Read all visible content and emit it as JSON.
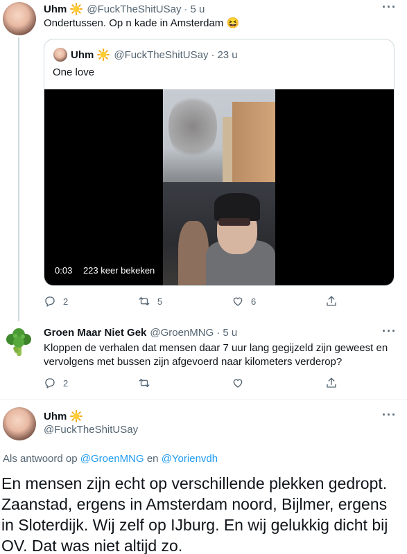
{
  "tweet1": {
    "name": "Uhm",
    "handle": "@FuckTheShitUSay",
    "dot": "·",
    "time": "5 u",
    "text": "Ondertussen. Op n kade in Amsterdam 😆",
    "quote": {
      "name": "Uhm",
      "handle": "@FuckTheShitUSay",
      "dot": "·",
      "time": "23 u",
      "text": "One love",
      "video_time": "0:03",
      "video_views": "223 keer bekeken"
    },
    "replies": "2",
    "retweets": "5",
    "likes": "6"
  },
  "tweet2": {
    "name": "Groen Maar Niet Gek",
    "handle": "@GroenMNG",
    "dot": "·",
    "time": "5 u",
    "text": "Kloppen de verhalen dat mensen daar 7 uur lang gegijzeld zijn geweest en vervolgens met bussen zijn afgevoerd naar kilometers verderop?",
    "replies": "2"
  },
  "tweet3": {
    "name": "Uhm",
    "handle": "@FuckTheShitUSay",
    "reply_prefix": "Als antwoord op",
    "reply_user1": "@GroenMNG",
    "reply_and": "en",
    "reply_user2": "@Yorienvdh",
    "text": "En mensen zijn echt op verschillende plekken gedropt. Zaanstad, ergens in Amsterdam noord, Bijlmer, ergens in Sloterdijk. Wij zelf op IJburg. En wij gelukkig dicht bij OV. Dat was niet altijd zo."
  },
  "icons": {
    "more": "···",
    "sun": "sun-emoji",
    "reply": "speech-bubble-icon",
    "retweet": "retweet-icon",
    "like": "heart-icon",
    "share": "share-icon"
  },
  "colors": {
    "link": "#1d9bf0",
    "secondary": "#536471",
    "line": "#cfd9de"
  }
}
